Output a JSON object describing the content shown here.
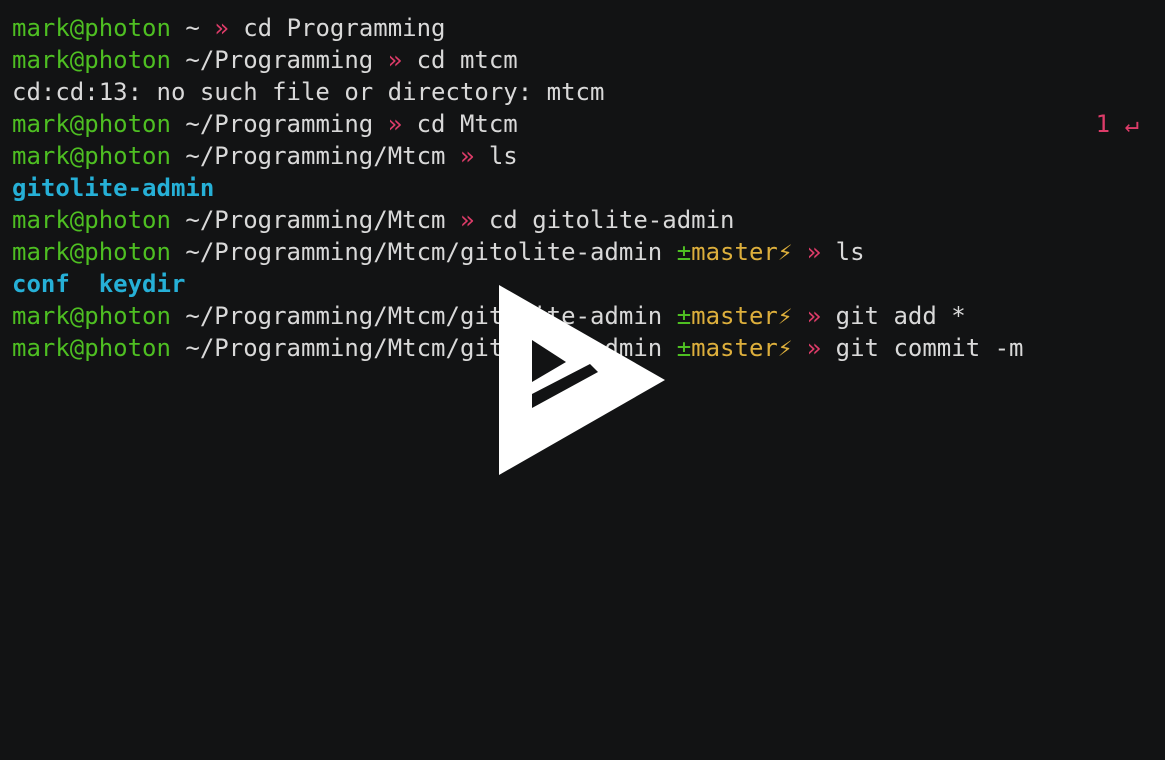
{
  "terminal": {
    "lines": [
      {
        "type": "prompt",
        "user": "mark",
        "host": "photon",
        "path": "~",
        "arrow": "»",
        "cmd": "cd Programming"
      },
      {
        "type": "prompt",
        "user": "mark",
        "host": "photon",
        "path": "~/Programming",
        "arrow": "»",
        "cmd": "cd mtcm"
      },
      {
        "type": "output",
        "text": "cd:cd:13: no such file or directory: mtcm"
      },
      {
        "type": "prompt",
        "user": "mark",
        "host": "photon",
        "path": "~/Programming",
        "arrow": "»",
        "cmd": "cd Mtcm",
        "status": "1 ↵"
      },
      {
        "type": "prompt",
        "user": "mark",
        "host": "photon",
        "path": "~/Programming/Mtcm",
        "arrow": "»",
        "cmd": "ls"
      },
      {
        "type": "dirs",
        "items": [
          "gitolite-admin"
        ]
      },
      {
        "type": "prompt",
        "user": "mark",
        "host": "photon",
        "path": "~/Programming/Mtcm",
        "arrow": "»",
        "cmd": "cd gitolite-admin"
      },
      {
        "type": "prompt",
        "user": "mark",
        "host": "photon",
        "path": "~/Programming/Mtcm/gitolite-admin",
        "git": {
          "pm": "±",
          "branch": "master",
          "bolt": "⚡"
        },
        "arrow": "»",
        "cmd": "ls"
      },
      {
        "type": "dirs",
        "items": [
          "conf",
          "keydir"
        ]
      },
      {
        "type": "prompt",
        "user": "mark",
        "host": "photon",
        "path": "~/Programming/Mtcm/gitolite-admin",
        "git": {
          "pm": "±",
          "branch": "master",
          "bolt": "⚡"
        },
        "arrow": "»",
        "cmd": "git add *"
      },
      {
        "type": "prompt",
        "user": "mark",
        "host": "photon",
        "path": "~/Programming/Mtcm/gitolite-admin",
        "git": {
          "pm": "±",
          "branch": "master",
          "bolt": "⚡"
        },
        "arrow": "»",
        "cmd": "git commit -m"
      }
    ]
  },
  "overlay": {
    "icon": "play-icon"
  },
  "colors": {
    "background": "#121314",
    "prompt_user": "#4ebf22",
    "arrow": "#dd3c69",
    "branch": "#ddaf3c",
    "directory": "#26b0d7",
    "text": "#d9d9d9"
  }
}
